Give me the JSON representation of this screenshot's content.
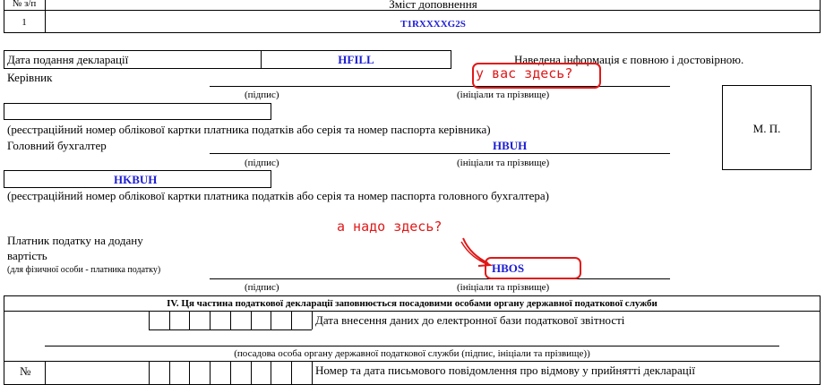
{
  "top_table": {
    "col_num": "№ з/п",
    "col_content": "Зміст доповнення",
    "row_num": "1",
    "row_value": "T1RXXXXG2S"
  },
  "decl": {
    "date_label": "Дата подання декларації",
    "date_value": "HFILL",
    "statement": "Наведена інформація є повною і достовірною."
  },
  "manager": {
    "label": "Керівник",
    "signature": "(підпис)",
    "initials": "(ініціали та прізвище)",
    "id_caption": "(реєстраційний номер облікової картки платника податків або серія та номер паспорта керівника)"
  },
  "stamp": "М. П.",
  "accountant": {
    "label": "Головний бухгалтер",
    "name_value": "HBUH",
    "signature": "(підпис)",
    "initials": "(ініціали та прізвище)",
    "id_value": "HKBUH",
    "id_caption": "(реєстраційний номер облікової картки платника податків або серія та номер паспорта  головного бухгалтера)"
  },
  "payer": {
    "label_line1": "Платник податку на додану",
    "label_line2": "вартість",
    "note": "(для фізичної особи - платника податку)",
    "name_value": "HBOS",
    "signature": "(підпис)",
    "initials": "(ініціали та прізвище)"
  },
  "annotations": {
    "here_you": "у вас здесь?",
    "need_here": "а надо здесь?"
  },
  "section4": {
    "title": "IV. Ця частина податкової декларації заповнюється посадовими  особами органу державної податкової служби",
    "date_entry": "Дата внесення даних до електронної бази податкової звітності",
    "official_caption": "(посадова особа органу державної податкової служби (підпис, ініціали та прізвище))",
    "num_label": "№",
    "refusal_label": "Номер та дата письмового повідомлення про відмову у прийнятті  декларації"
  },
  "colors": {
    "annotation": "#e01818",
    "value": "#1c1cd4"
  }
}
